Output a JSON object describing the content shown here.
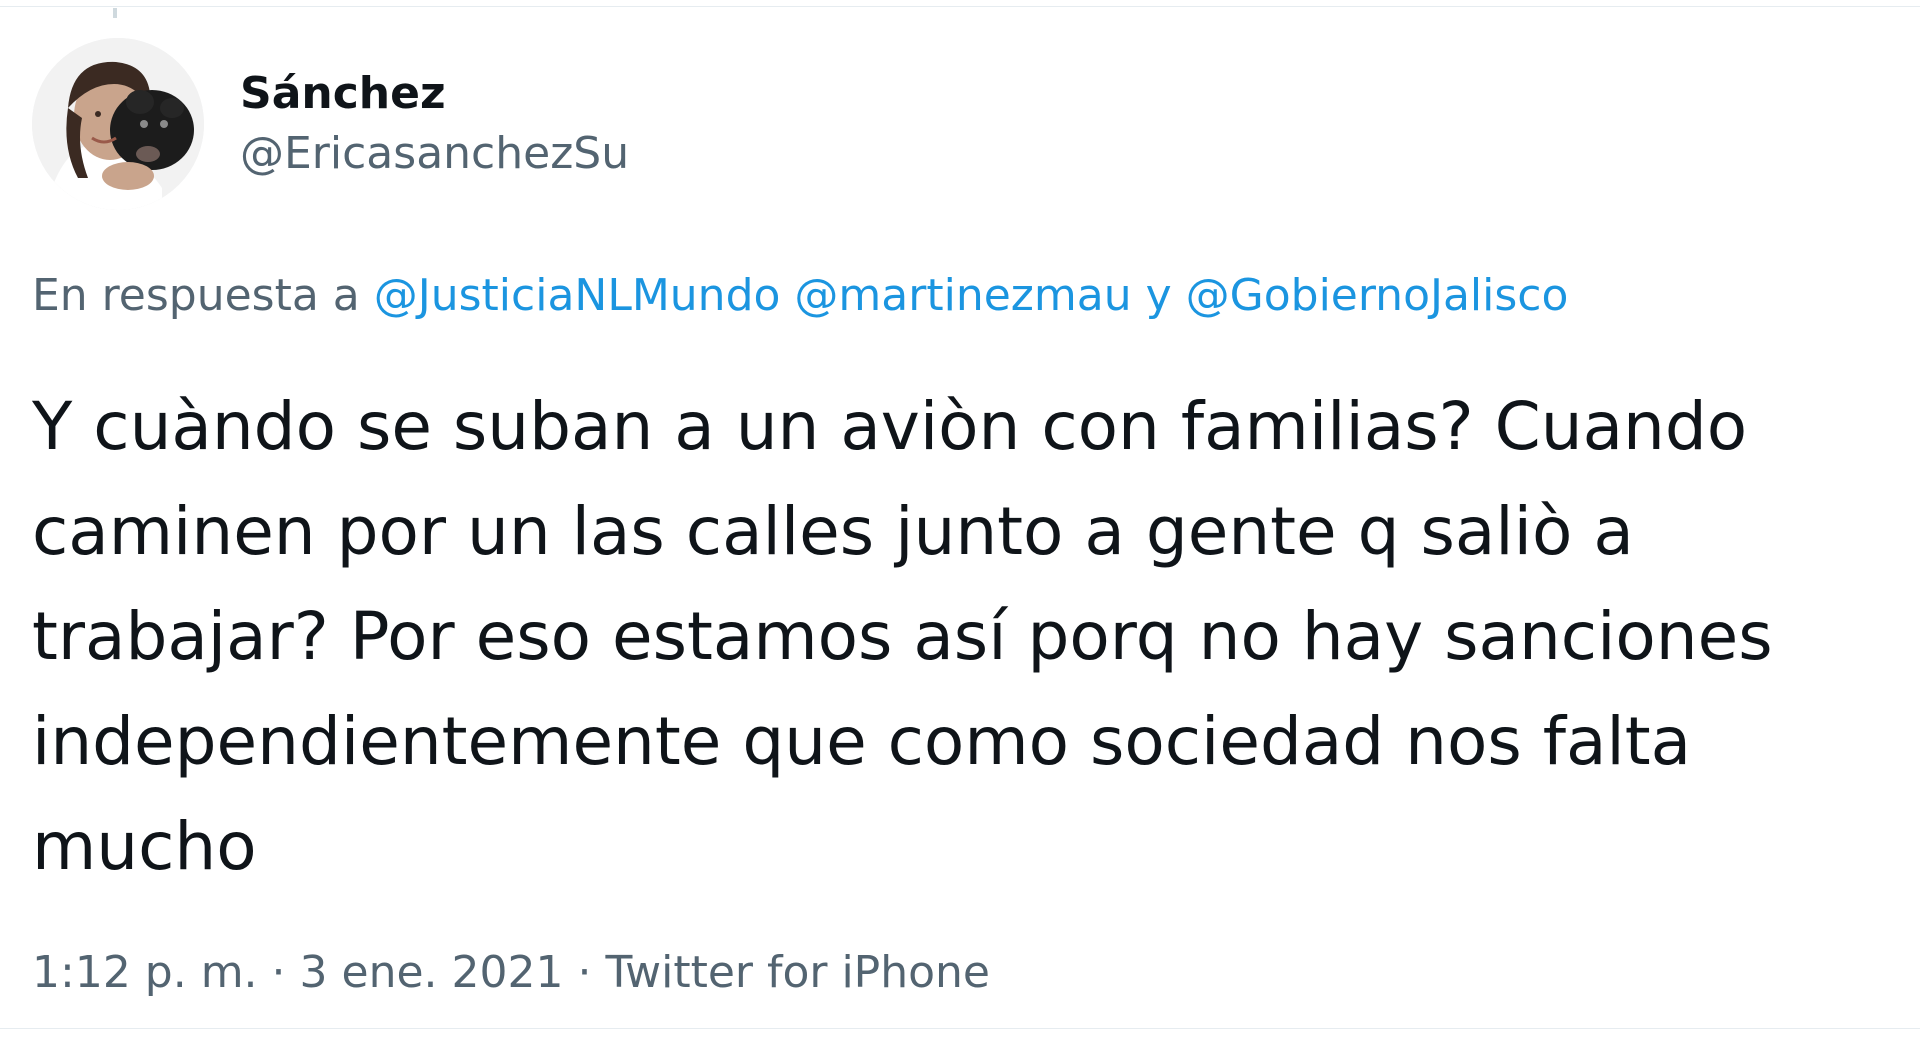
{
  "tweet": {
    "author": {
      "display_name": "Sánchez",
      "handle": "@EricasanchezSu"
    },
    "reply_to": {
      "prefix": "En respuesta a",
      "mentions": [
        "@JusticiaNLMundo",
        "@martinezmau",
        "@GobiernoJalisco"
      ],
      "conjunction": "y"
    },
    "text": "Y cuàndo se suban a un aviòn con familias? Cuando caminen por un las calles junto a gente q saliò a trabajar? Por eso estamos así porq no hay sanciones independientemente que como sociedad nos falta mucho",
    "meta": {
      "time": "1:12 p. m.",
      "date": "3 ene. 2021",
      "source": "Twitter for iPhone",
      "separator": "·"
    }
  },
  "colors": {
    "link": "#1b95e0",
    "secondary_text": "#536471",
    "primary_text": "#0f1419"
  }
}
